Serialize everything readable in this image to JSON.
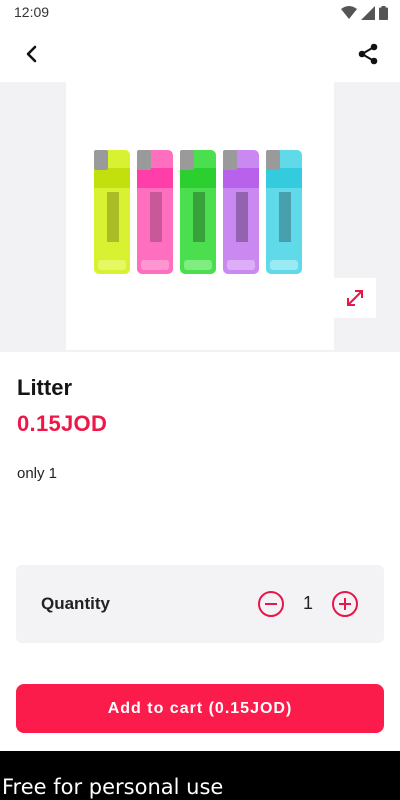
{
  "status_bar": {
    "time": "12:09",
    "icons": [
      "wifi-icon",
      "signal-icon",
      "battery-icon"
    ]
  },
  "app_bar": {
    "back_icon": "chevron-left-icon",
    "share_icon": "share-icon"
  },
  "gallery": {
    "image_subject": "five translucent lighters in yellow, pink, green, purple and cyan",
    "lighter_colors": [
      "#d4ef1a",
      "#ff5fb8",
      "#37dc3c",
      "#c47cf0",
      "#4fd6e6"
    ],
    "expand_icon": "expand-arrows-icon"
  },
  "product": {
    "name": "Litter",
    "price": "0.15JOD",
    "stock_note": "only 1"
  },
  "quantity": {
    "label": "Quantity",
    "value": "1",
    "minus_icon": "minus-circle-icon",
    "plus_icon": "plus-circle-icon"
  },
  "cart": {
    "button_label": "Add to cart (0.15JOD)"
  },
  "footer": {
    "text": "Free for personal use"
  },
  "colors": {
    "accent": "#fb1c4b",
    "price": "#ee1848",
    "gallery_bg": "#f2f2f4",
    "card_bg": "#f3f3f6"
  }
}
